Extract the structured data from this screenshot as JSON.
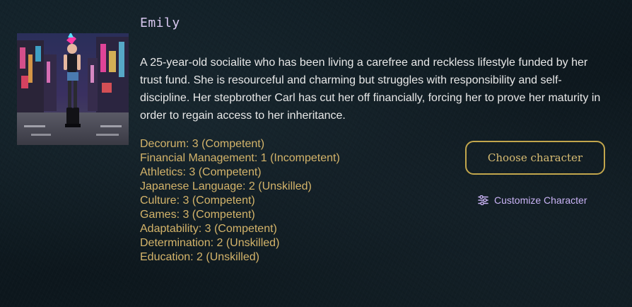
{
  "character": {
    "name": "Emily",
    "portrait_alt": "Portrait of Emily: punk woman with pink mohawk on a neon-lit city street at night",
    "bio": "A 25-year-old socialite who has been living a carefree and reckless lifestyle funded by her trust fund. She is resourceful and charming but struggles with responsibility and self-discipline. Her stepbrother Carl has cut her off financially, forcing her to prove her maturity in order to regain access to her inheritance.",
    "skills": [
      "Decorum: 3 (Competent)",
      "Financial Management: 1 (Incompetent)",
      "Athletics: 3 (Competent)",
      "Japanese Language: 2 (Unskilled)",
      "Culture: 3 (Competent)",
      "Games: 3 (Competent)",
      "Adaptability: 3 (Competent)",
      "Determination: 2 (Unskilled)",
      "Education: 2 (Unskilled)"
    ]
  },
  "actions": {
    "choose_label": "Choose character",
    "customize_label": "Customize Character",
    "customize_icon": "sliders-icon"
  },
  "colors": {
    "background": "#0f1a20",
    "name": "#d8c8f0",
    "skills": "#d4b46a",
    "button_border": "#c2a64c",
    "link": "#c9b3f5"
  }
}
